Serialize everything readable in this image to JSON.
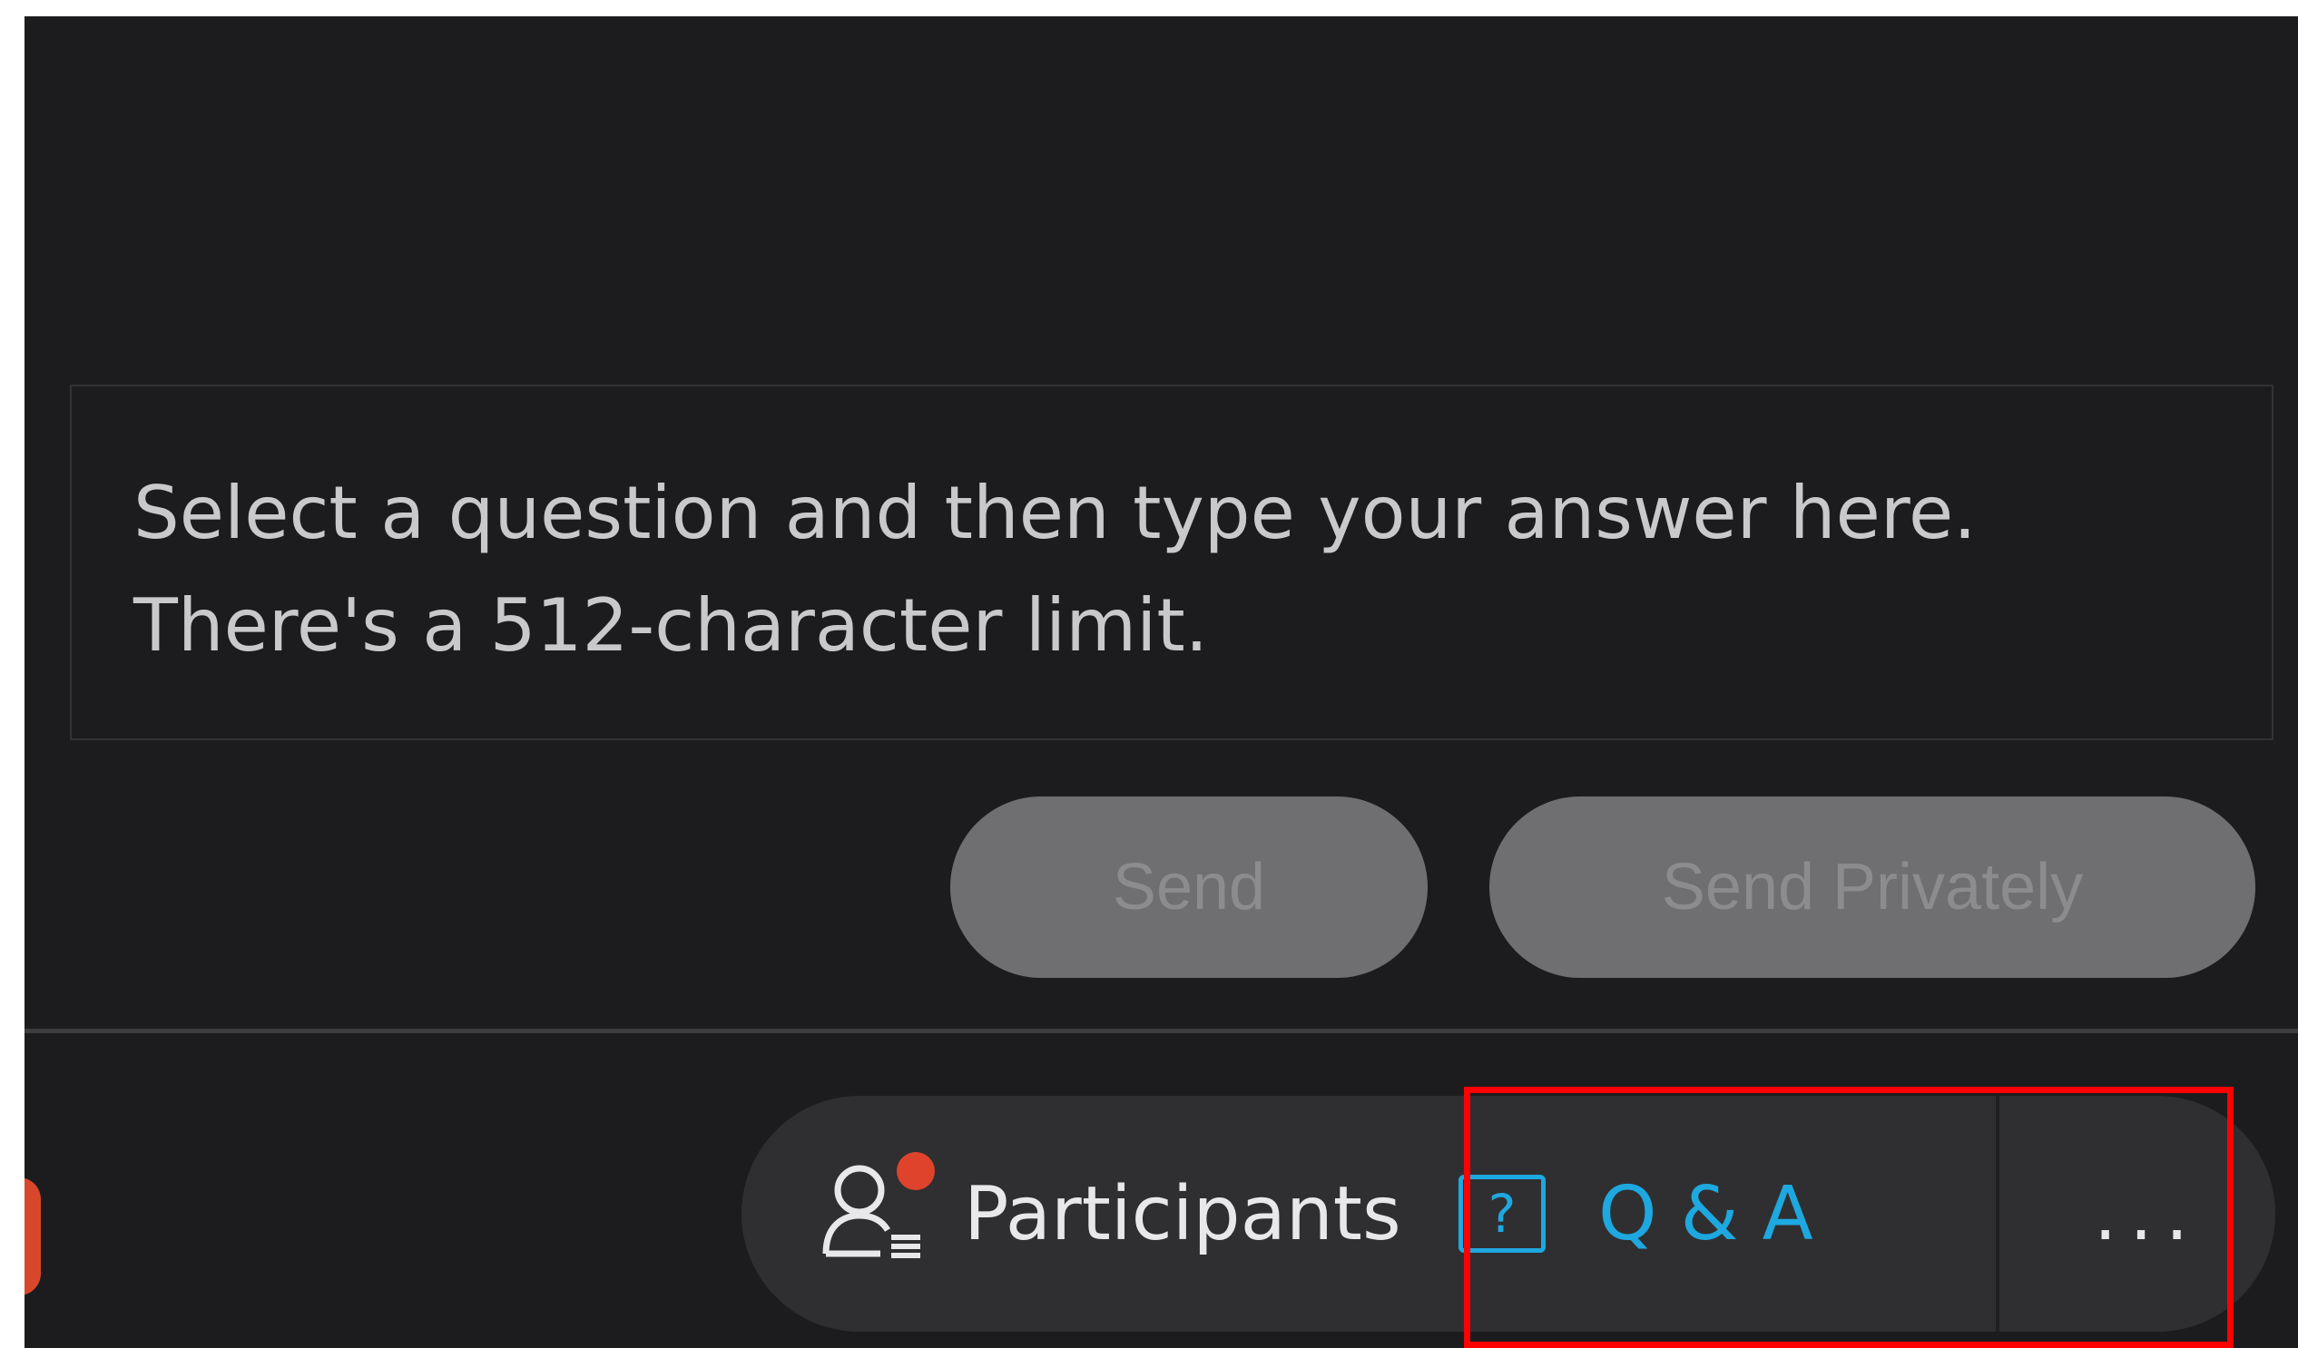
{
  "answer": {
    "placeholder": "Select a question and then type your answer here.\nThere's a 512-character limit."
  },
  "actions": {
    "send_label": "Send",
    "send_privately_label": "Send Privately"
  },
  "toolbar": {
    "participants_label": "Participants",
    "qa_label": "Q & A",
    "qa_icon_glyph": "?",
    "more_label": "...",
    "icons": [
      "participants-icon",
      "question-mark-icon",
      "more-icon"
    ]
  },
  "colors": {
    "background": "#1c1c1e",
    "accent": "#1ea8e0",
    "notification": "#e0432b",
    "highlight": "#ff0000"
  }
}
